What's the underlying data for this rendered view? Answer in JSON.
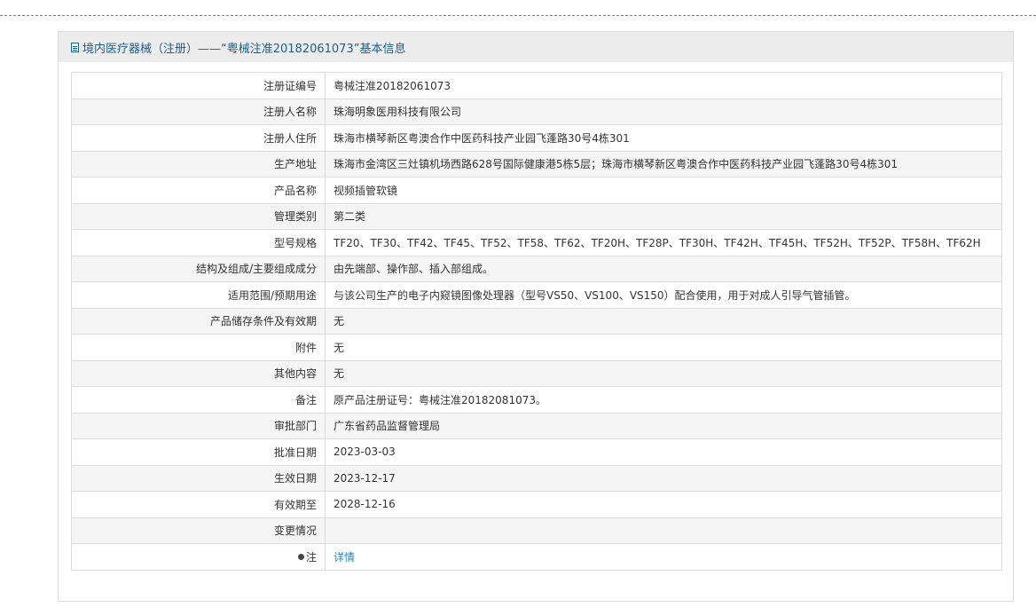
{
  "header": {
    "title": "境内医疗器械（注册）——“粤械注准20182061073”基本信息"
  },
  "rows": [
    {
      "label": "注册证编号",
      "value": "粤械注准20182061073"
    },
    {
      "label": "注册人名称",
      "value": "珠海明象医用科技有限公司"
    },
    {
      "label": "注册人住所",
      "value": "珠海市横琴新区粤澳合作中医药科技产业园飞蓬路30号4栋301"
    },
    {
      "label": "生产地址",
      "value": "珠海市金湾区三灶镇机场西路628号国际健康港5栋5层；珠海市横琴新区粤澳合作中医药科技产业园飞蓬路30号4栋301"
    },
    {
      "label": "产品名称",
      "value": "视频插管软镜"
    },
    {
      "label": "管理类别",
      "value": "第二类"
    },
    {
      "label": "型号规格",
      "value": "TF20、TF30、TF42、TF45、TF52、TF58、TF62、TF20H、TF28P、TF30H、TF42H、TF45H、TF52H、TF52P、TF58H、TF62H"
    },
    {
      "label": "结构及组成/主要组成成分",
      "value": "由先端部、操作部、插入部组成。"
    },
    {
      "label": "适用范围/预期用途",
      "value": "与该公司生产的电子内窥镜图像处理器（型号VS50、VS100、VS150）配合使用，用于对成人引导气管插管。"
    },
    {
      "label": "产品储存条件及有效期",
      "value": "无"
    },
    {
      "label": "附件",
      "value": "无"
    },
    {
      "label": "其他内容",
      "value": "无"
    },
    {
      "label": "备注",
      "value": "原产品注册证号：粤械注准20182081073。"
    },
    {
      "label": "审批部门",
      "value": "广东省药品监督管理局"
    },
    {
      "label": "批准日期",
      "value": "2023-03-03"
    },
    {
      "label": "生效日期",
      "value": "2023-12-17"
    },
    {
      "label": "有效期至",
      "value": "2028-12-16"
    },
    {
      "label": "变更情况",
      "value": ""
    }
  ],
  "note_row": {
    "label": "注",
    "link_label": "详情"
  }
}
